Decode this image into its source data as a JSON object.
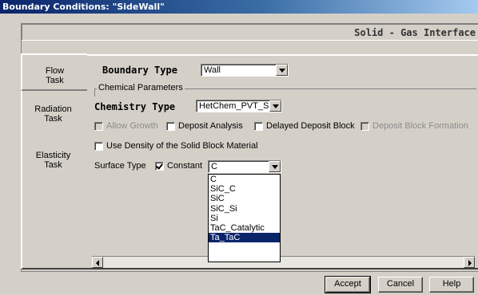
{
  "window": {
    "title": "Boundary Conditions: \"SideWall\""
  },
  "interface_label": "Solid - Gas Interface",
  "tabs": [
    {
      "label": "Flow\nTask",
      "active": true
    },
    {
      "label": "Radiation\nTask",
      "active": false
    },
    {
      "label": "Elasticity\nTask",
      "active": false
    }
  ],
  "boundary_type": {
    "label": "Boundary Type",
    "value": "Wall"
  },
  "chemical": {
    "group_label": "Chemical Parameters",
    "chemistry_label": "Chemistry Type",
    "chemistry_value": "HetChem_PVT_SiC",
    "checks": [
      {
        "label": "Allow Growth",
        "checked": false,
        "disabled": true
      },
      {
        "label": "Deposit Analysis",
        "checked": false,
        "disabled": false
      },
      {
        "label": "Delayed Deposit Block",
        "checked": false,
        "disabled": false
      },
      {
        "label": "Deposit Block Formation",
        "checked": false,
        "disabled": true
      }
    ],
    "density_label": "Use Density of the Solid Block Material",
    "density_checked": false
  },
  "surface": {
    "label": "Surface Type",
    "constant_label": "Constant",
    "constant_checked": true,
    "value": "C",
    "options": [
      "C",
      "SiC_C",
      "SiC",
      "SiC_Si",
      "Si",
      "TaC_Catalytic",
      "Ta_TaC"
    ],
    "highlighted": "Ta_TaC"
  },
  "buttons": {
    "accept": "Accept",
    "cancel": "Cancel",
    "help": "Help"
  }
}
